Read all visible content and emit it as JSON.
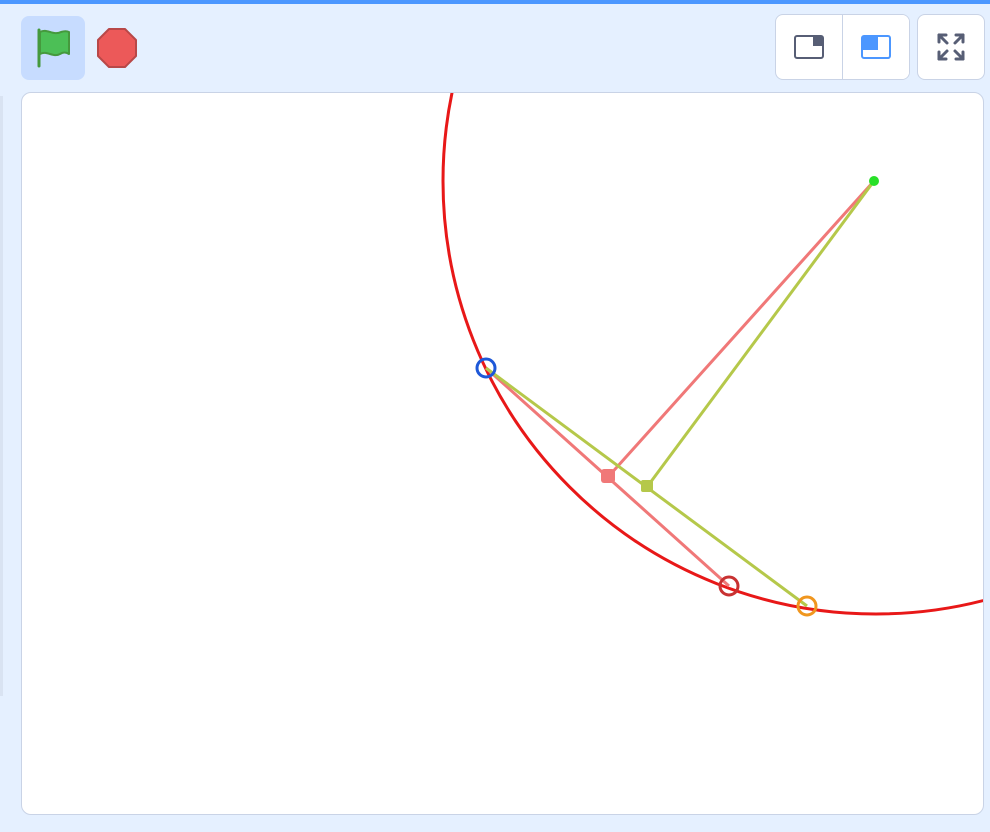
{
  "toolbar": {
    "green_flag_icon": "green-flag-icon",
    "stop_icon": "stop-icon",
    "small_stage_icon": "small-stage-icon",
    "large_stage_icon": "large-stage-icon",
    "fullscreen_icon": "fullscreen-icon"
  },
  "colors": {
    "accent": "#4c97ff",
    "toolbar_bg": "#e5f0ff",
    "active_button_bg": "#c7dcff",
    "flag_green": "#4cbf56",
    "stop_red": "#ec5959",
    "circle_red": "#e81818",
    "salmon_line": "#f07878",
    "olive_line": "#b5c84a",
    "blue_marker": "#1e58d8",
    "dark_red_marker": "#c83232",
    "orange_marker": "#f0961e",
    "green_point": "#28e028"
  },
  "stage": {
    "shapes": [
      "red-circle",
      "salmon-line-to-center",
      "olive-line-to-center",
      "blue-ring-marker",
      "dark-red-ring-marker",
      "orange-ring-marker",
      "salmon-midpoint",
      "olive-midpoint",
      "green-center-point"
    ]
  }
}
